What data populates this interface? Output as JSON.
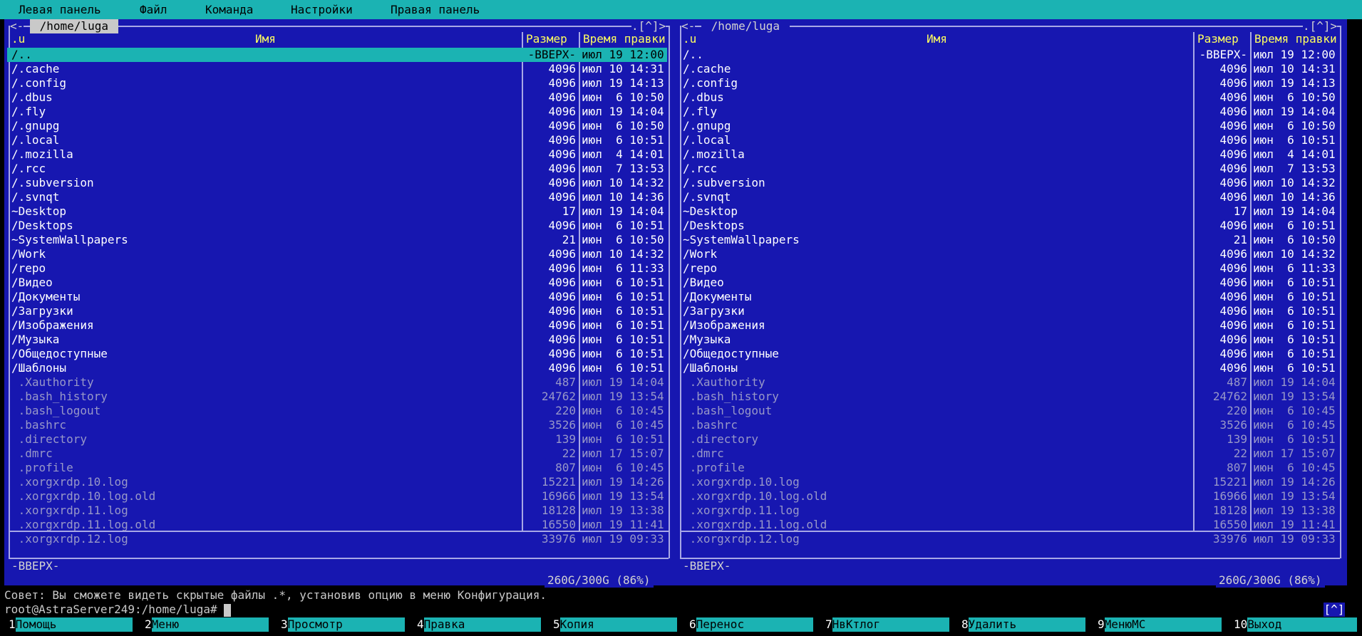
{
  "menubar": {
    "items": [
      "Левая панель",
      "Файл",
      "Команда",
      "Настройки",
      "Правая панель"
    ]
  },
  "colors": {
    "panel_bg": "#1717b0",
    "cyan": "#1bb3b3",
    "header_yellow": "#ffff5f",
    "border": "#a8a8e6"
  },
  "left_panel": {
    "path": " /home/luga ",
    "corner_left": "<-",
    "corner_right": ".[^]>",
    "sort_indicator": ".u",
    "col_name": "Имя",
    "col_size": "Размер",
    "col_time": "Время правки",
    "status": "-ВВЕРХ-",
    "free": "260G/300G (86%)"
  },
  "right_panel": {
    "path": " /home/luga ",
    "corner_left": "<-",
    "corner_right": ".[^]>",
    "sort_indicator": ".u",
    "col_name": "Имя",
    "col_size": "Размер",
    "col_time": "Время правки",
    "status": "-ВВЕРХ-",
    "free": "260G/300G (86%)"
  },
  "files": [
    {
      "name": "/..",
      "size": "-ВВЕРХ-",
      "time": "июл 19 12:00",
      "type": "dir"
    },
    {
      "name": "/.cache",
      "size": "4096",
      "time": "июл 10 14:31",
      "type": "dir"
    },
    {
      "name": "/.config",
      "size": "4096",
      "time": "июл 19 14:13",
      "type": "dir"
    },
    {
      "name": "/.dbus",
      "size": "4096",
      "time": "июн  6 10:50",
      "type": "dir"
    },
    {
      "name": "/.fly",
      "size": "4096",
      "time": "июл 19 14:04",
      "type": "dir"
    },
    {
      "name": "/.gnupg",
      "size": "4096",
      "time": "июн  6 10:50",
      "type": "dir"
    },
    {
      "name": "/.local",
      "size": "4096",
      "time": "июн  6 10:51",
      "type": "dir"
    },
    {
      "name": "/.mozilla",
      "size": "4096",
      "time": "июл  4 14:01",
      "type": "dir"
    },
    {
      "name": "/.rcc",
      "size": "4096",
      "time": "июл  7 13:53",
      "type": "dir"
    },
    {
      "name": "/.subversion",
      "size": "4096",
      "time": "июл 10 14:32",
      "type": "dir"
    },
    {
      "name": "/.svnqt",
      "size": "4096",
      "time": "июл 10 14:36",
      "type": "dir"
    },
    {
      "name": "~Desktop",
      "size": "17",
      "time": "июл 19 14:04",
      "type": "dir"
    },
    {
      "name": "/Desktops",
      "size": "4096",
      "time": "июн  6 10:51",
      "type": "dir"
    },
    {
      "name": "~SystemWallpapers",
      "size": "21",
      "time": "июн  6 10:50",
      "type": "dir"
    },
    {
      "name": "/Work",
      "size": "4096",
      "time": "июл 10 14:32",
      "type": "dir"
    },
    {
      "name": "/repo",
      "size": "4096",
      "time": "июн  6 11:33",
      "type": "dir"
    },
    {
      "name": "/Видео",
      "size": "4096",
      "time": "июн  6 10:51",
      "type": "dir"
    },
    {
      "name": "/Документы",
      "size": "4096",
      "time": "июн  6 10:51",
      "type": "dir"
    },
    {
      "name": "/Загрузки",
      "size": "4096",
      "time": "июн  6 10:51",
      "type": "dir"
    },
    {
      "name": "/Изображения",
      "size": "4096",
      "time": "июн  6 10:51",
      "type": "dir"
    },
    {
      "name": "/Музыка",
      "size": "4096",
      "time": "июн  6 10:51",
      "type": "dir"
    },
    {
      "name": "/Общедоступные",
      "size": "4096",
      "time": "июн  6 10:51",
      "type": "dir"
    },
    {
      "name": "/Шаблоны",
      "size": "4096",
      "time": "июн  6 10:51",
      "type": "dir"
    },
    {
      "name": " .Xauthority",
      "size": "487",
      "time": "июл 19 14:04",
      "type": "file"
    },
    {
      "name": " .bash_history",
      "size": "24762",
      "time": "июл 19 13:54",
      "type": "file"
    },
    {
      "name": " .bash_logout",
      "size": "220",
      "time": "июн  6 10:45",
      "type": "file"
    },
    {
      "name": " .bashrc",
      "size": "3526",
      "time": "июн  6 10:45",
      "type": "file"
    },
    {
      "name": " .directory",
      "size": "139",
      "time": "июн  6 10:51",
      "type": "file"
    },
    {
      "name": " .dmrc",
      "size": "22",
      "time": "июл 17 15:07",
      "type": "file"
    },
    {
      "name": " .profile",
      "size": "807",
      "time": "июн  6 10:45",
      "type": "file"
    },
    {
      "name": " .xorgxrdp.10.log",
      "size": "15221",
      "time": "июл 19 14:26",
      "type": "file"
    },
    {
      "name": " .xorgxrdp.10.log.old",
      "size": "16966",
      "time": "июл 19 13:54",
      "type": "file"
    },
    {
      "name": " .xorgxrdp.11.log",
      "size": "18128",
      "time": "июл 19 13:38",
      "type": "file"
    },
    {
      "name": " .xorgxrdp.11.log.old",
      "size": "16550",
      "time": "июл 19 11:41",
      "type": "file"
    },
    {
      "name": " .xorgxrdp.12.log",
      "size": "33976",
      "time": "июл 19 09:33",
      "type": "file"
    }
  ],
  "hint": "Совет: Вы сможете видеть скрытые файлы .*, установив опцию в меню Конфигурация.",
  "prompt": "root@AstraServer249:/home/luga# ",
  "history_button": "[^]",
  "fkeys": [
    {
      "num": "1",
      "label": "Помощь"
    },
    {
      "num": "2",
      "label": "Меню"
    },
    {
      "num": "3",
      "label": "Просмотр"
    },
    {
      "num": "4",
      "label": "Правка"
    },
    {
      "num": "5",
      "label": "Копия"
    },
    {
      "num": "6",
      "label": "Перенос"
    },
    {
      "num": "7",
      "label": "НвКтлог"
    },
    {
      "num": "8",
      "label": "Удалить"
    },
    {
      "num": "9",
      "label": "МенюМС"
    },
    {
      "num": "10",
      "label": "Выход"
    }
  ]
}
